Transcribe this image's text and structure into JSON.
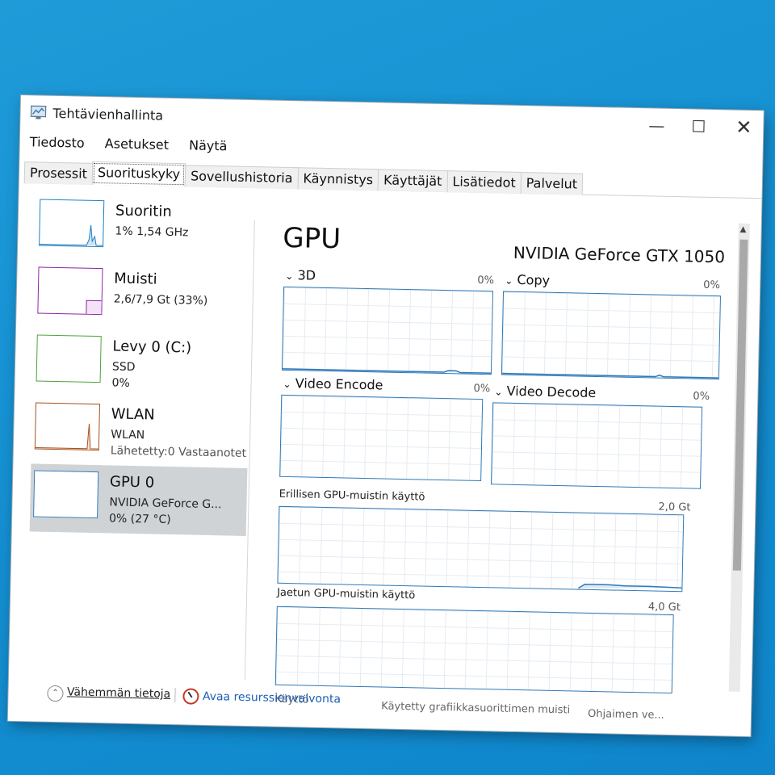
{
  "window": {
    "title": "Tehtävienhallinta"
  },
  "menu": [
    "Tiedosto",
    "Asetukset",
    "Näytä"
  ],
  "tabs": [
    {
      "label": "Prosessit",
      "active": false
    },
    {
      "label": "Suorituskyky",
      "active": true
    },
    {
      "label": "Sovellushistoria",
      "active": false
    },
    {
      "label": "Käynnistys",
      "active": false
    },
    {
      "label": "Käyttäjät",
      "active": false
    },
    {
      "label": "Lisätiedot",
      "active": false
    },
    {
      "label": "Palvelut",
      "active": false
    }
  ],
  "sidebar": [
    {
      "title": "Suoritin",
      "sub": "1%  1,54 GHz",
      "sub2": "",
      "color": "#1f7fc4"
    },
    {
      "title": "Muisti",
      "sub": "2,6/7,9 Gt (33%)",
      "sub2": "",
      "color": "#8b27a6"
    },
    {
      "title": "Levy 0 (C:)",
      "sub": "SSD",
      "sub2": "0%",
      "color": "#4da33b"
    },
    {
      "title": "WLAN",
      "sub": "WLAN",
      "sub2": "Lähetetty:0  Vastaanotet",
      "color": "#a5531a"
    },
    {
      "title": "GPU 0",
      "sub": "NVIDIA GeForce G...",
      "sub2": "0%  (27 °C)",
      "color": "#2f79b8"
    }
  ],
  "main": {
    "title": "GPU",
    "model": "NVIDIA GeForce GTX 1050",
    "engines": [
      {
        "label": "3D",
        "pct": "0%"
      },
      {
        "label": "Copy",
        "pct": "0%"
      },
      {
        "label": "Video Encode",
        "pct": "0%"
      },
      {
        "label": "Video Decode",
        "pct": "0%"
      }
    ],
    "dedicated": {
      "label": "Erillisen GPU-muistin käyttö",
      "max": "2,0 Gt"
    },
    "shared": {
      "label": "Jaetun GPU-muistin käyttö",
      "max": "4,0 Gt"
    },
    "footer": {
      "usage": "Käyttö",
      "used_mem": "Käytetty grafiikkasuorittimen muisti",
      "driver": "Ohjaimen ve..."
    }
  },
  "bottom": {
    "less": "Vähemmän tietoja",
    "resmon": "Avaa resurssienvalvonta"
  },
  "icons": {
    "chevron": "chevron-down-icon",
    "up": "chevron-up-icon",
    "resmon": "resource-monitor-icon"
  }
}
